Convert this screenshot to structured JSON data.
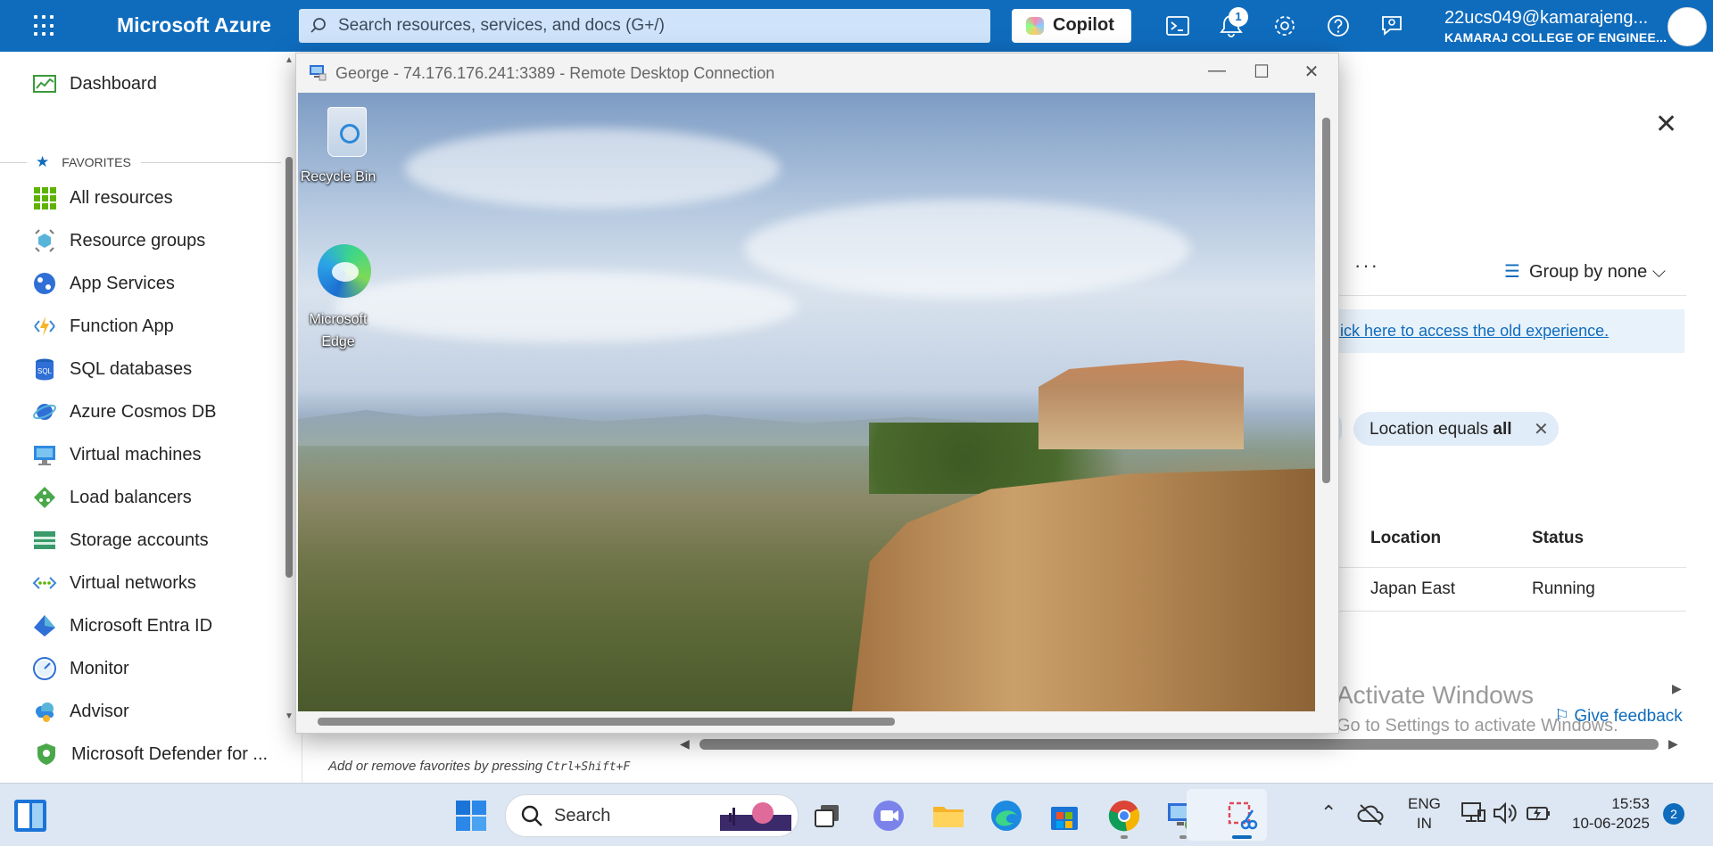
{
  "topbar": {
    "brand": "Microsoft Azure",
    "search_placeholder": "Search resources, services, and docs (G+/)",
    "copilot_label": "Copilot",
    "notification_count": "1",
    "account_email": "22ucs049@kamarajeng...",
    "account_org": "KAMARAJ COLLEGE OF ENGINEE..."
  },
  "sidebar": {
    "dashboard": "Dashboard",
    "favorites_label": "FAVORITES",
    "items": [
      {
        "label": "All resources",
        "icon": "grid-icon"
      },
      {
        "label": "Resource groups",
        "icon": "cube-icon"
      },
      {
        "label": "App Services",
        "icon": "globe-icon"
      },
      {
        "label": "Function App",
        "icon": "lightning-icon"
      },
      {
        "label": "SQL databases",
        "icon": "sql-icon"
      },
      {
        "label": "Azure Cosmos DB",
        "icon": "planet-icon"
      },
      {
        "label": "Virtual machines",
        "icon": "monitor-icon"
      },
      {
        "label": "Load balancers",
        "icon": "diamond-icon"
      },
      {
        "label": "Storage accounts",
        "icon": "storage-icon"
      },
      {
        "label": "Virtual networks",
        "icon": "network-icon"
      },
      {
        "label": "Microsoft Entra ID",
        "icon": "entra-icon"
      },
      {
        "label": "Monitor",
        "icon": "gauge-icon"
      },
      {
        "label": "Advisor",
        "icon": "cloud-icon"
      },
      {
        "label": "Microsoft Defender for ...",
        "icon": "shield-icon"
      }
    ],
    "hint_prefix": "Add or remove favorites by pressing ",
    "hint_keys": "Ctrl+Shift+F"
  },
  "background_panel": {
    "more": "···",
    "group_by": "Group by none",
    "old_experience_link": "lick here to access the old experience.",
    "filter_label": "Location equals ",
    "filter_value": "all",
    "columns": [
      "Location",
      "Status"
    ],
    "row": [
      "Japan East",
      "Running"
    ],
    "activate_title": "Activate Windows",
    "activate_sub": "Go to Settings to activate Windows.",
    "feedback": "Give feedback"
  },
  "rdp": {
    "title": "George - 74.176.176.241:3389 - Remote Desktop Connection",
    "desktop_icons": [
      "Recycle Bin",
      "Microsoft Edge"
    ]
  },
  "taskbar": {
    "search_label": "Search",
    "lang_1": "ENG",
    "lang_2": "IN",
    "time": "15:53",
    "date": "10-06-2025",
    "notifications": "2"
  },
  "colors": {
    "azure_blue": "#0f6cbd",
    "taskbar_bg": "#dde7f3"
  }
}
